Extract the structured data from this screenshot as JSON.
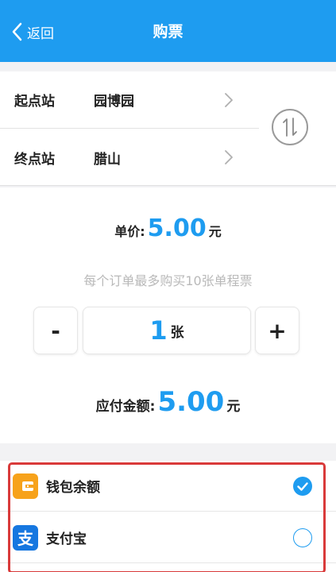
{
  "header": {
    "back_label": "返回",
    "title": "购票"
  },
  "stations": {
    "start": {
      "label": "起点站",
      "value": "园博园"
    },
    "end": {
      "label": "终点站",
      "value": "腊山"
    }
  },
  "ticket": {
    "unit_price_label": "单价:",
    "unit_price": "5.00",
    "unit_price_unit": "元",
    "limit_note": "每个订单最多购买10张单程票",
    "minus_label": "-",
    "plus_label": "+",
    "quantity": "1",
    "quantity_unit": "张",
    "total_label": "应付金额:",
    "total": "5.00",
    "total_unit": "元"
  },
  "payment": {
    "methods": [
      {
        "label": "钱包余额",
        "icon": "wallet-icon",
        "selected": true
      },
      {
        "label": "支付宝",
        "icon": "alipay-icon",
        "icon_char": "支",
        "selected": false
      }
    ]
  },
  "colors": {
    "accent": "#1e9cf0",
    "highlight_border": "#d93a3a"
  }
}
